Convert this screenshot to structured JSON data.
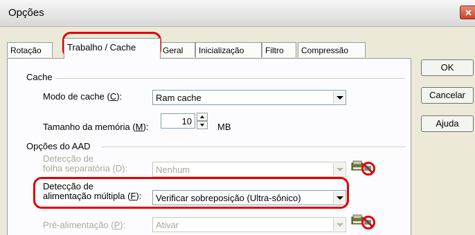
{
  "window": {
    "title": "Opções"
  },
  "tabs": [
    {
      "label": "Rotação"
    },
    {
      "label": "Trabalho / Cache"
    },
    {
      "label": "Geral"
    },
    {
      "label": "Inicialização"
    },
    {
      "label": "Filtro"
    },
    {
      "label": "Compressão"
    }
  ],
  "buttons": {
    "ok": "OK",
    "cancel": "Cancelar",
    "help": "Ajuda"
  },
  "cache": {
    "group_label": "Cache",
    "mode_label_pre": "Modo de cache (",
    "mode_label_key": "C",
    "mode_label_post": "):",
    "mode_value": "Ram cache",
    "memory_label_pre": "Tamanho da memória (",
    "memory_label_key": "M",
    "memory_label_post": "):",
    "memory_value": "10",
    "memory_unit": "MB"
  },
  "aad": {
    "group_label": "Opções do AAD",
    "separator_label_1": "Detecção de",
    "separator_label_2": "folha separatória (D):",
    "separator_value": "Nenhum",
    "multifeed_label_1": "Detecção de",
    "multifeed_label_2_pre": "alimentação múltipla (",
    "multifeed_label_2_key": "F",
    "multifeed_label_2_post": "):",
    "multifeed_value": "Verificar sobreposição (Ultra-sônico)",
    "prefeed_label_pre": "Pré-alimentação (",
    "prefeed_label_key": "P",
    "prefeed_label_post": "):",
    "prefeed_value": "Ativar"
  },
  "colors": {
    "highlight": "#e00000",
    "disabled_text": "#a9a99a",
    "dialog_bg": "#ece9d8"
  }
}
